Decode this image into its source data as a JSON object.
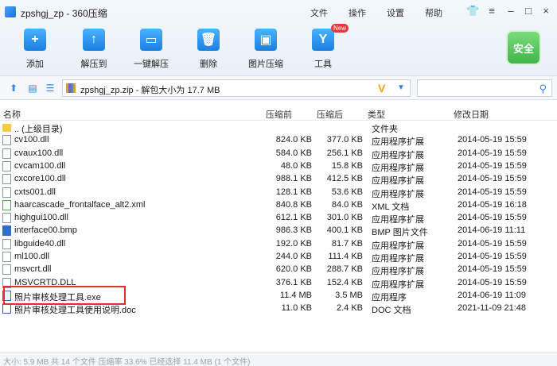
{
  "window": {
    "title": "zpshgj_zp - 360压缩",
    "menus": [
      "文件",
      "操作",
      "设置",
      "帮助"
    ]
  },
  "toolbar": {
    "tools": [
      {
        "label": "添加",
        "icon": "add-icon"
      },
      {
        "label": "解压到",
        "icon": "extract-icon"
      },
      {
        "label": "一键解压",
        "icon": "one-click-extract-icon"
      },
      {
        "label": "删除",
        "icon": "delete-icon"
      },
      {
        "label": "图片压缩",
        "icon": "image-compress-icon"
      },
      {
        "label": "工具",
        "icon": "tools-icon",
        "badge": "New"
      }
    ],
    "security_label": "安全"
  },
  "address": {
    "path": "zpshgj_zp.zip - 解包大小为 17.7 MB",
    "search_placeholder": ""
  },
  "columns": {
    "name": "名称",
    "packed": "压缩前",
    "compressed": "压缩后",
    "type": "类型",
    "modified": "修改日期"
  },
  "files": [
    {
      "name": ".. (上级目录)",
      "packed": "",
      "compressed": "",
      "type": "文件夹",
      "modified": "",
      "icon": "folder"
    },
    {
      "name": "cv100.dll",
      "packed": "824.0 KB",
      "compressed": "377.0 KB",
      "type": "应用程序扩展",
      "modified": "2014-05-19 15:59",
      "icon": "dll"
    },
    {
      "name": "cvaux100.dll",
      "packed": "584.0 KB",
      "compressed": "256.1 KB",
      "type": "应用程序扩展",
      "modified": "2014-05-19 15:59",
      "icon": "dll"
    },
    {
      "name": "cvcam100.dll",
      "packed": "48.0 KB",
      "compressed": "15.8 KB",
      "type": "应用程序扩展",
      "modified": "2014-05-19 15:59",
      "icon": "dll"
    },
    {
      "name": "cxcore100.dll",
      "packed": "988.1 KB",
      "compressed": "412.5 KB",
      "type": "应用程序扩展",
      "modified": "2014-05-19 15:59",
      "icon": "dll"
    },
    {
      "name": "cxts001.dll",
      "packed": "128.1 KB",
      "compressed": "53.6 KB",
      "type": "应用程序扩展",
      "modified": "2014-05-19 15:59",
      "icon": "dll"
    },
    {
      "name": "haarcascade_frontalface_alt2.xml",
      "packed": "840.8 KB",
      "compressed": "84.0 KB",
      "type": "XML 文档",
      "modified": "2014-05-19 16:18",
      "icon": "xml"
    },
    {
      "name": "highgui100.dll",
      "packed": "612.1 KB",
      "compressed": "301.0 KB",
      "type": "应用程序扩展",
      "modified": "2014-05-19 15:59",
      "icon": "dll"
    },
    {
      "name": "interface00.bmp",
      "packed": "986.3 KB",
      "compressed": "400.1 KB",
      "type": "BMP 图片文件",
      "modified": "2014-06-19 11:11",
      "icon": "bmp"
    },
    {
      "name": "libguide40.dll",
      "packed": "192.0 KB",
      "compressed": "81.7 KB",
      "type": "应用程序扩展",
      "modified": "2014-05-19 15:59",
      "icon": "dll"
    },
    {
      "name": "ml100.dll",
      "packed": "244.0 KB",
      "compressed": "111.4 KB",
      "type": "应用程序扩展",
      "modified": "2014-05-19 15:59",
      "icon": "dll"
    },
    {
      "name": "msvcrt.dll",
      "packed": "620.0 KB",
      "compressed": "288.7 KB",
      "type": "应用程序扩展",
      "modified": "2014-05-19 15:59",
      "icon": "dll"
    },
    {
      "name": "MSVCRTD.DLL",
      "packed": "376.1 KB",
      "compressed": "152.4 KB",
      "type": "应用程序扩展",
      "modified": "2014-05-19 15:59",
      "icon": "dll"
    },
    {
      "name": "照片审核处理工具.exe",
      "packed": "11.4 MB",
      "compressed": "3.5 MB",
      "type": "应用程序",
      "modified": "2014-06-19 11:09",
      "icon": "exe"
    },
    {
      "name": "照片审核处理工具使用说明.doc",
      "packed": "11.0 KB",
      "compressed": "2.4 KB",
      "type": "DOC 文档",
      "modified": "2021-11-09 21:48",
      "icon": "doc"
    }
  ],
  "status": "大小: 5.9 MB 共 14 个文件 压缩率 33.6% 已经选择 11.4 MB (1 个文件)"
}
